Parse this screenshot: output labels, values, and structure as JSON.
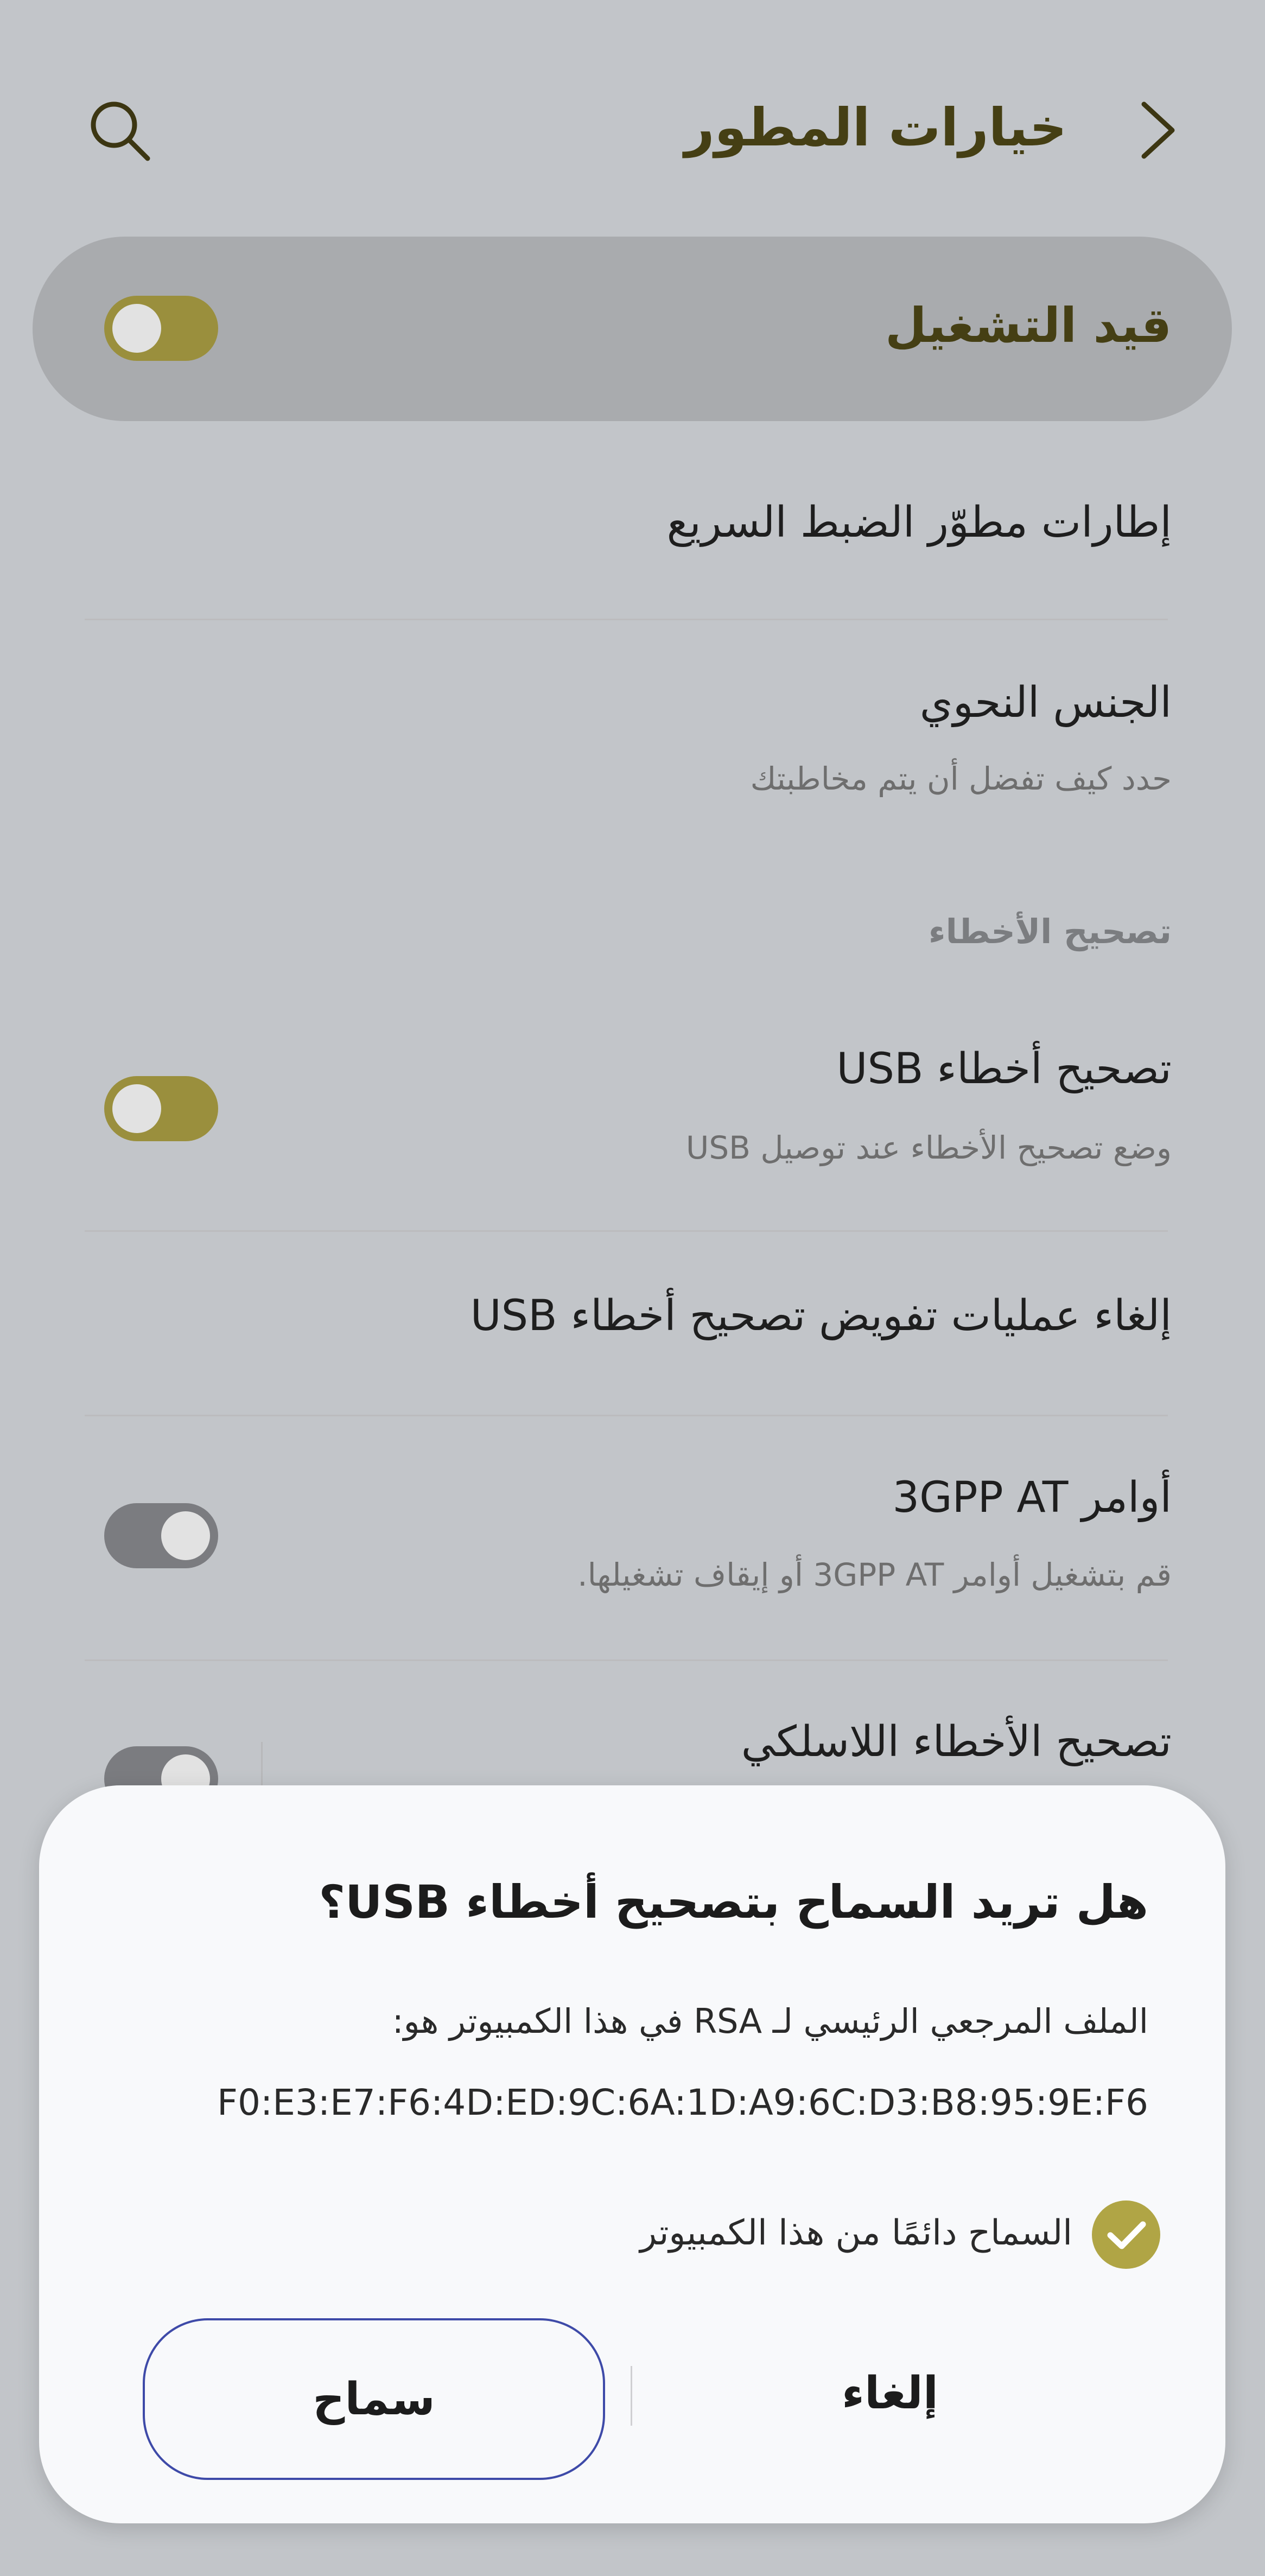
{
  "header": {
    "title": "خيارات المطور",
    "back_icon": "chevron-right-icon",
    "search_icon": "search-icon"
  },
  "master": {
    "label": "قيد التشغيل",
    "enabled": true
  },
  "card1": {
    "items": [
      {
        "title": "إطارات مطوّر الضبط السريع"
      },
      {
        "title": "الجنس النحوي",
        "subtitle": "حدد كيف تفضل أن يتم مخاطبتك"
      }
    ]
  },
  "section": {
    "debugging_header": "تصحيح الأخطاء"
  },
  "card2": {
    "items": [
      {
        "title": "تصحيح أخطاء USB",
        "subtitle": "وضع تصحيح الأخطاء عند توصيل USB",
        "toggle": true
      },
      {
        "title": "إلغاء عمليات تفويض تصحيح أخطاء USB"
      },
      {
        "title": "أوامر 3GPP AT",
        "subtitle": "قم بتشغيل أوامر 3GPP AT أو إيقاف تشغيلها.",
        "toggle": false
      },
      {
        "title": "تصحيح الأخطاء اللاسلكي",
        "toggle": false
      }
    ]
  },
  "dialog": {
    "title": "هل تريد السماح بتصحيح أخطاء USB؟",
    "message": "الملف المرجعي الرئيسي لـ RSA في هذا الكمبيوتر هو:",
    "fingerprint": "F0:E3:E7:F6:4D:ED:9C:6A:1D:A9:6C:D3:B8:95:9E:F6",
    "always_allow_label": "السماح دائمًا من هذا الكمبيوتر",
    "always_allow_checked": true,
    "cancel_label": "إلغاء",
    "allow_label": "سماح"
  },
  "colors": {
    "accent": "#9a8f3d",
    "title_text": "#453f14",
    "focus_outline": "#3e4aa8"
  }
}
